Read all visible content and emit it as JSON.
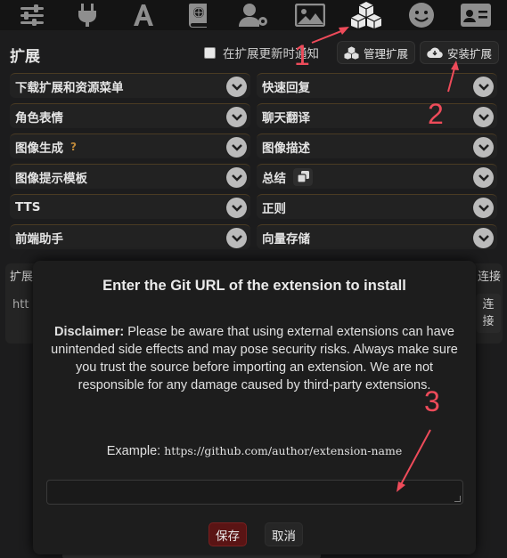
{
  "topbar": {
    "icons": [
      "sliders-icon",
      "plug-icon",
      "font-icon",
      "book-globe-icon",
      "user-gear-icon",
      "image-icon",
      "cubes-icon",
      "smile-icon",
      "id-card-icon"
    ],
    "active_icon": "cubes-icon"
  },
  "extensions": {
    "title": "扩展",
    "notify_label": "在扩展更新时通知",
    "manage_label": "管理扩展",
    "install_label": "安装扩展"
  },
  "drawers": {
    "left": [
      "下载扩展和资源菜单",
      "角色表情",
      "图像生成",
      "图像提示模板",
      "TTS",
      "前端助手"
    ],
    "right": [
      "快速回复",
      "聊天翻译",
      "图像描述",
      "总结",
      "正则",
      "向量存储"
    ],
    "help_mark": "?"
  },
  "background": {
    "left_partial": "扩展",
    "input_partial": "htt",
    "connect_top": "连接",
    "connect_btn_line1": "连",
    "connect_btn_line2": "接"
  },
  "modal": {
    "title": "Enter the Git URL of the extension to install",
    "disclaimer_bold": "Disclaimer:",
    "disclaimer_text": " Please be aware that using external extensions can have unintended side effects and may pose security risks. Always make sure you trust the source before importing an extension. We are not responsible for any damage caused by third-party extensions.",
    "example_label": "Example:",
    "example_url": "https://github.com/author/extension-name",
    "input_value": "",
    "save_label": "保存",
    "cancel_label": "取消"
  },
  "annotations": {
    "one": "1",
    "two": "2",
    "three": "3",
    "color": "#ee4b5a"
  }
}
